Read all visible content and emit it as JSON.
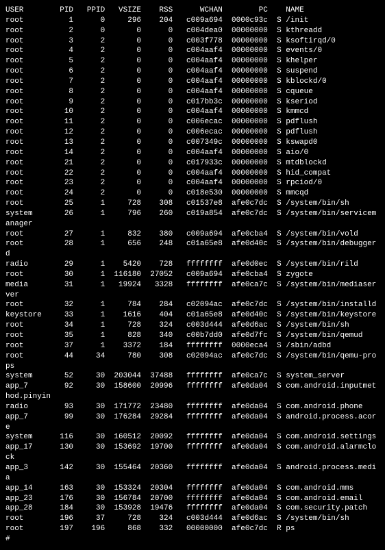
{
  "headers": {
    "user": "USER",
    "pid": "PID",
    "ppid": "PPID",
    "vsize": "VSIZE",
    "rss": "RSS",
    "wchan": "WCHAN",
    "pc": "PC",
    "flag": "",
    "name": "NAME"
  },
  "rows": [
    {
      "user": "root",
      "pid": "1",
      "ppid": "0",
      "vsize": "296",
      "rss": "204",
      "wchan": "c009a694",
      "pc": "0000c93c",
      "flag": "S",
      "name": "/init"
    },
    {
      "user": "root",
      "pid": "2",
      "ppid": "0",
      "vsize": "0",
      "rss": "0",
      "wchan": "c004dea0",
      "pc": "00000000",
      "flag": "S",
      "name": "kthreadd"
    },
    {
      "user": "root",
      "pid": "3",
      "ppid": "2",
      "vsize": "0",
      "rss": "0",
      "wchan": "c003f778",
      "pc": "00000000",
      "flag": "S",
      "name": "ksoftirqd/0"
    },
    {
      "user": "root",
      "pid": "4",
      "ppid": "2",
      "vsize": "0",
      "rss": "0",
      "wchan": "c004aaf4",
      "pc": "00000000",
      "flag": "S",
      "name": "events/0"
    },
    {
      "user": "root",
      "pid": "5",
      "ppid": "2",
      "vsize": "0",
      "rss": "0",
      "wchan": "c004aaf4",
      "pc": "00000000",
      "flag": "S",
      "name": "khelper"
    },
    {
      "user": "root",
      "pid": "6",
      "ppid": "2",
      "vsize": "0",
      "rss": "0",
      "wchan": "c004aaf4",
      "pc": "00000000",
      "flag": "S",
      "name": "suspend"
    },
    {
      "user": "root",
      "pid": "7",
      "ppid": "2",
      "vsize": "0",
      "rss": "0",
      "wchan": "c004aaf4",
      "pc": "00000000",
      "flag": "S",
      "name": "kblockd/0"
    },
    {
      "user": "root",
      "pid": "8",
      "ppid": "2",
      "vsize": "0",
      "rss": "0",
      "wchan": "c004aaf4",
      "pc": "00000000",
      "flag": "S",
      "name": "cqueue"
    },
    {
      "user": "root",
      "pid": "9",
      "ppid": "2",
      "vsize": "0",
      "rss": "0",
      "wchan": "c017bb3c",
      "pc": "00000000",
      "flag": "S",
      "name": "kseriod"
    },
    {
      "user": "root",
      "pid": "10",
      "ppid": "2",
      "vsize": "0",
      "rss": "0",
      "wchan": "c004aaf4",
      "pc": "00000000",
      "flag": "S",
      "name": "kmmcd"
    },
    {
      "user": "root",
      "pid": "11",
      "ppid": "2",
      "vsize": "0",
      "rss": "0",
      "wchan": "c006ecac",
      "pc": "00000000",
      "flag": "S",
      "name": "pdflush"
    },
    {
      "user": "root",
      "pid": "12",
      "ppid": "2",
      "vsize": "0",
      "rss": "0",
      "wchan": "c006ecac",
      "pc": "00000000",
      "flag": "S",
      "name": "pdflush"
    },
    {
      "user": "root",
      "pid": "13",
      "ppid": "2",
      "vsize": "0",
      "rss": "0",
      "wchan": "c007349c",
      "pc": "00000000",
      "flag": "S",
      "name": "kswapd0"
    },
    {
      "user": "root",
      "pid": "14",
      "ppid": "2",
      "vsize": "0",
      "rss": "0",
      "wchan": "c004aaf4",
      "pc": "00000000",
      "flag": "S",
      "name": "aio/0"
    },
    {
      "user": "root",
      "pid": "21",
      "ppid": "2",
      "vsize": "0",
      "rss": "0",
      "wchan": "c017933c",
      "pc": "00000000",
      "flag": "S",
      "name": "mtdblockd"
    },
    {
      "user": "root",
      "pid": "22",
      "ppid": "2",
      "vsize": "0",
      "rss": "0",
      "wchan": "c004aaf4",
      "pc": "00000000",
      "flag": "S",
      "name": "hid_compat"
    },
    {
      "user": "root",
      "pid": "23",
      "ppid": "2",
      "vsize": "0",
      "rss": "0",
      "wchan": "c004aaf4",
      "pc": "00000000",
      "flag": "S",
      "name": "rpciod/0"
    },
    {
      "user": "root",
      "pid": "24",
      "ppid": "2",
      "vsize": "0",
      "rss": "0",
      "wchan": "c018e530",
      "pc": "00000000",
      "flag": "S",
      "name": "mmcqd"
    },
    {
      "user": "root",
      "pid": "25",
      "ppid": "1",
      "vsize": "728",
      "rss": "308",
      "wchan": "c01537e8",
      "pc": "afe0c7dc",
      "flag": "S",
      "name": "/system/bin/sh"
    },
    {
      "user": "system",
      "pid": "26",
      "ppid": "1",
      "vsize": "796",
      "rss": "260",
      "wchan": "c019a854",
      "pc": "afe0c7dc",
      "flag": "S",
      "name": "/system/bin/servicemanager",
      "wrap": "r"
    },
    {
      "user": "root",
      "pid": "27",
      "ppid": "1",
      "vsize": "832",
      "rss": "380",
      "wchan": "c009a694",
      "pc": "afe0cba4",
      "flag": "S",
      "name": "/system/bin/vold"
    },
    {
      "user": "root",
      "pid": "28",
      "ppid": "1",
      "vsize": "656",
      "rss": "248",
      "wchan": "c01a65e8",
      "pc": "afe0d40c",
      "flag": "S",
      "name": "/system/bin/debuggerd"
    },
    {
      "user": "radio",
      "pid": "29",
      "ppid": "1",
      "vsize": "5420",
      "rss": "728",
      "wchan": "ffffffff",
      "pc": "afe0d0ec",
      "flag": "S",
      "name": "/system/bin/rild"
    },
    {
      "user": "root",
      "pid": "30",
      "ppid": "1",
      "vsize": "116180",
      "rss": "27052",
      "wchan": "c009a694",
      "pc": "afe0cba4",
      "flag": "S",
      "name": "zygote"
    },
    {
      "user": "media",
      "pid": "31",
      "ppid": "1",
      "vsize": "19924",
      "rss": "3328",
      "wchan": "ffffffff",
      "pc": "afe0ca7c",
      "flag": "S",
      "name": "/system/bin/mediaserver"
    },
    {
      "user": "root",
      "pid": "32",
      "ppid": "1",
      "vsize": "784",
      "rss": "284",
      "wchan": "c02094ac",
      "pc": "afe0c7dc",
      "flag": "S",
      "name": "/system/bin/installd"
    },
    {
      "user": "keystore",
      "pid": "33",
      "ppid": "1",
      "vsize": "1616",
      "rss": "404",
      "wchan": "c01a65e8",
      "pc": "afe0d40c",
      "flag": "S",
      "name": "/system/bin/keystore"
    },
    {
      "user": "root",
      "pid": "34",
      "ppid": "1",
      "vsize": "728",
      "rss": "324",
      "wchan": "c003d444",
      "pc": "afe0d6ac",
      "flag": "S",
      "name": "/system/bin/sh"
    },
    {
      "user": "root",
      "pid": "35",
      "ppid": "1",
      "vsize": "828",
      "rss": "340",
      "wchan": "c00b7dd0",
      "pc": "afe0d7fc",
      "flag": "S",
      "name": "/system/bin/qemud"
    },
    {
      "user": "root",
      "pid": "37",
      "ppid": "1",
      "vsize": "3372",
      "rss": "184",
      "wchan": "ffffffff",
      "pc": "0000eca4",
      "flag": "S",
      "name": "/sbin/adbd"
    },
    {
      "user": "root",
      "pid": "44",
      "ppid": "34",
      "vsize": "780",
      "rss": "308",
      "wchan": "c02094ac",
      "pc": "afe0c7dc",
      "flag": "S",
      "name": "/system/bin/qemu-props"
    },
    {
      "user": "system",
      "pid": "52",
      "ppid": "30",
      "vsize": "203044",
      "rss": "37488",
      "wchan": "ffffffff",
      "pc": "afe0ca7c",
      "flag": "S",
      "name": "system_server"
    },
    {
      "user": "app_7",
      "pid": "92",
      "ppid": "30",
      "vsize": "158600",
      "rss": "20996",
      "wchan": "ffffffff",
      "pc": "afe0da04",
      "flag": "S",
      "name": "com.android.inputmethod.pinyin",
      "wrap": "inyin"
    },
    {
      "user": "radio",
      "pid": "93",
      "ppid": "30",
      "vsize": "171772",
      "rss": "23480",
      "wchan": "ffffffff",
      "pc": "afe0da04",
      "flag": "S",
      "name": "com.android.phone"
    },
    {
      "user": "app_7",
      "pid": "99",
      "ppid": "30",
      "vsize": "176284",
      "rss": "29284",
      "wchan": "ffffffff",
      "pc": "afe0da04",
      "flag": "S",
      "name": "android.process.acore"
    },
    {
      "user": "system",
      "pid": "116",
      "ppid": "30",
      "vsize": "160512",
      "rss": "20092",
      "wchan": "ffffffff",
      "pc": "afe0da04",
      "flag": "S",
      "name": "com.android.settings"
    },
    {
      "user": "app_17",
      "pid": "130",
      "ppid": "30",
      "vsize": "153692",
      "rss": "19700",
      "wchan": "ffffffff",
      "pc": "afe0da04",
      "flag": "S",
      "name": "com.android.alarmclock"
    },
    {
      "user": "app_3",
      "pid": "142",
      "ppid": "30",
      "vsize": "155464",
      "rss": "20360",
      "wchan": "ffffffff",
      "pc": "afe0da04",
      "flag": "S",
      "name": "android.process.media"
    },
    {
      "user": "app_14",
      "pid": "163",
      "ppid": "30",
      "vsize": "153324",
      "rss": "20304",
      "wchan": "ffffffff",
      "pc": "afe0da04",
      "flag": "S",
      "name": "com.android.mms"
    },
    {
      "user": "app_23",
      "pid": "176",
      "ppid": "30",
      "vsize": "156784",
      "rss": "20700",
      "wchan": "ffffffff",
      "pc": "afe0da04",
      "flag": "S",
      "name": "com.android.email"
    },
    {
      "user": "app_28",
      "pid": "184",
      "ppid": "30",
      "vsize": "153928",
      "rss": "19476",
      "wchan": "ffffffff",
      "pc": "afe0da04",
      "flag": "S",
      "name": "com.security.patch"
    },
    {
      "user": "root",
      "pid": "196",
      "ppid": "37",
      "vsize": "728",
      "rss": "324",
      "wchan": "c003d444",
      "pc": "afe0d6ac",
      "flag": "S",
      "name": "/system/bin/sh"
    },
    {
      "user": "root",
      "pid": "197",
      "ppid": "196",
      "vsize": "868",
      "rss": "332",
      "wchan": "00000000",
      "pc": "afe0c7dc",
      "flag": "R",
      "name": "ps"
    }
  ],
  "prompt": "#"
}
